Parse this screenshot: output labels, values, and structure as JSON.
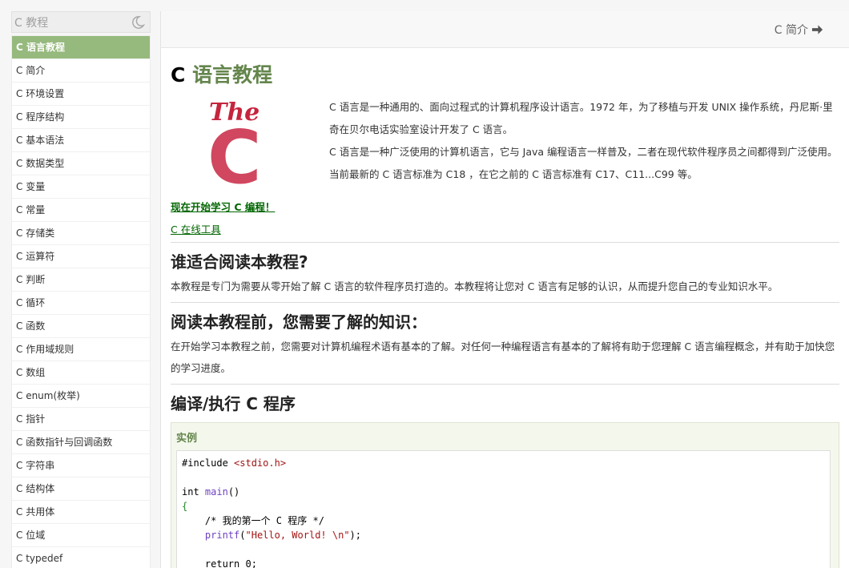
{
  "sidebar": {
    "title": "C 教程",
    "items": [
      {
        "label": "C 语言教程",
        "active": true
      },
      {
        "label": "C 简介"
      },
      {
        "label": "C 环境设置"
      },
      {
        "label": "C 程序结构"
      },
      {
        "label": "C 基本语法"
      },
      {
        "label": "C 数据类型"
      },
      {
        "label": "C 变量"
      },
      {
        "label": "C 常量"
      },
      {
        "label": "C 存储类"
      },
      {
        "label": "C 运算符"
      },
      {
        "label": "C 判断"
      },
      {
        "label": "C 循环"
      },
      {
        "label": "C 函数"
      },
      {
        "label": "C 作用域规则"
      },
      {
        "label": "C 数组"
      },
      {
        "label": "C enum(枚举)"
      },
      {
        "label": "C 指针"
      },
      {
        "label": "C 函数指针与回调函数"
      },
      {
        "label": "C 字符串"
      },
      {
        "label": "C 结构体"
      },
      {
        "label": "C 共用体"
      },
      {
        "label": "C 位域"
      },
      {
        "label": "C typedef"
      }
    ]
  },
  "topbar": {
    "next_label": "C 简介"
  },
  "page": {
    "title_prefix": "C",
    "title_accent": "语言教程",
    "logo": {
      "word": "The",
      "letter": "C"
    },
    "intro_1": "C 语言是一种通用的、面向过程式的计算机程序设计语言。1972 年，为了移植与开发 UNIX 操作系统，丹尼斯·里奇在贝尔电话实验室设计开发了 C 语言。",
    "intro_2": "C 语言是一种广泛使用的计算机语言，它与 Java 编程语言一样普及，二者在现代软件程序员之间都得到广泛使用。",
    "intro_3": "当前最新的 C 语言标准为 C18 ，在它之前的 C 语言标准有 C17、C11...C99 等。",
    "start_link": "现在开始学习 C 编程！",
    "online_tool_link": "C 在线工具",
    "section1_title": "谁适合阅读本教程?",
    "section1_text": "本教程是专门为需要从零开始了解 C 语言的软件程序员打造的。本教程将让您对 C 语言有足够的认识，从而提升您自己的专业知识水平。",
    "section2_title": "阅读本教程前，您需要了解的知识：",
    "section2_text": "在开始学习本教程之前，您需要对计算机编程术语有基本的了解。对任何一种编程语言有基本的了解将有助于您理解 C 语言编程概念，并有助于加快您的学习进度。",
    "section3_title": "编译/执行 C 程序",
    "example_label": "实例",
    "code": {
      "l1_a": "#include ",
      "l1_b": "<stdio.h>",
      "l3_a": "int ",
      "l3_b": "main",
      "l3_c": "()",
      "l4": "{",
      "l5": "    /* 我的第一个 C 程序 */",
      "l6_a": "    ",
      "l6_b": "printf",
      "l6_c": "(",
      "l6_d": "\"Hello, World! \\n\"",
      "l6_e": ");",
      "l8": "    return 0;"
    }
  }
}
